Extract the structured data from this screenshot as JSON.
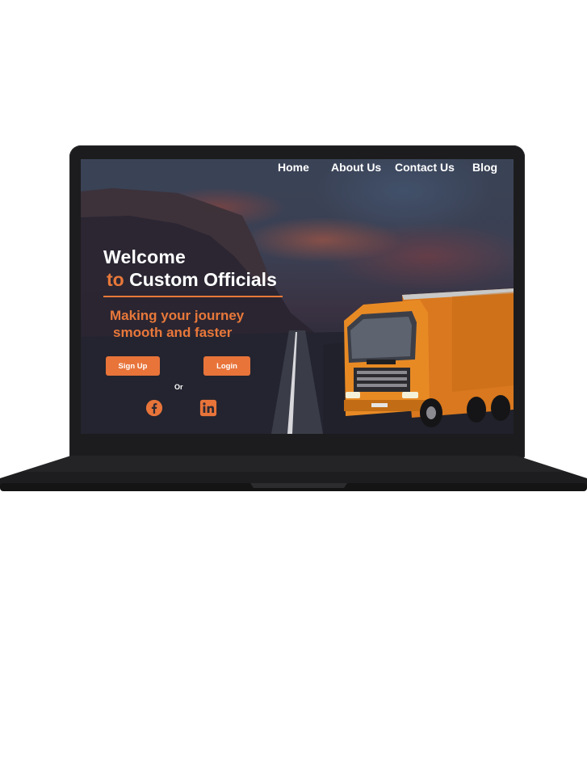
{
  "nav": {
    "home": "Home",
    "about": "About Us",
    "contact": "Contact Us",
    "blog": "Blog"
  },
  "hero": {
    "title_line1": "Welcome",
    "title_accent": "to",
    "title_rest": "Custom Officials",
    "tagline_line1": "Making your journey",
    "tagline_line2": "smooth and faster"
  },
  "actions": {
    "signup": "Sign Up",
    "login": "Login",
    "or": "Or"
  },
  "social": {
    "facebook": "facebook-icon",
    "linkedin": "linkedin-icon"
  },
  "colors": {
    "accent": "#e8783a",
    "laptop": "#1c1c1e"
  }
}
